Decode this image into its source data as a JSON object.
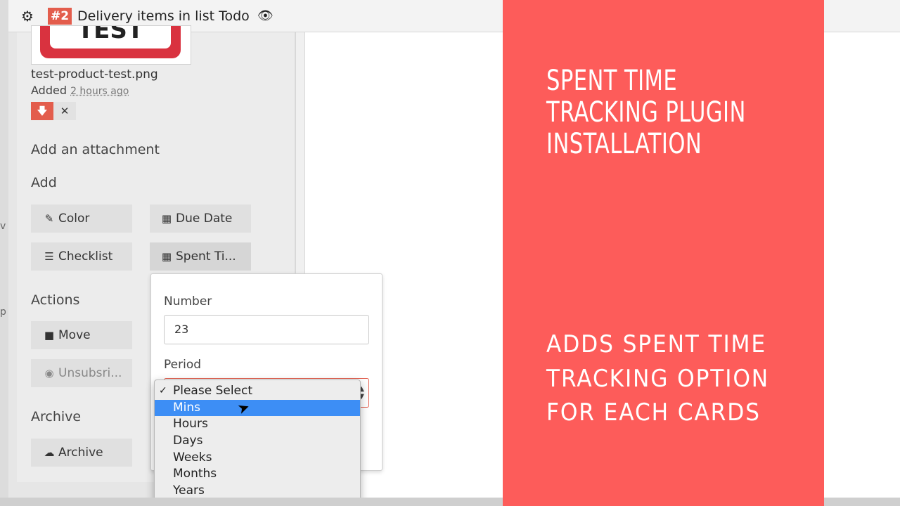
{
  "header": {
    "card_number": "#2",
    "title": "Delivery items in list Todo"
  },
  "attachment": {
    "image_text": "TEST",
    "filename": "test-product-test.png",
    "added_label": "Added",
    "added_time": "2 hours ago"
  },
  "sidebar": {
    "add_attachment": "Add an attachment",
    "add_heading": "Add",
    "buttons": {
      "color": "Color",
      "due_date": "Due Date",
      "checklist": "Checklist",
      "spent_time": "Spent Ti..."
    },
    "actions_heading": "Actions",
    "move": "Move",
    "unsubscribe": "Unsubsri...",
    "archive_heading": "Archive",
    "archive": "Archive"
  },
  "popup": {
    "number_label": "Number",
    "number_value": "23",
    "period_label": "Period"
  },
  "dropdown": {
    "selected": "Please Select",
    "highlighted": "Mins",
    "options": [
      "Please Select",
      "Mins",
      "Hours",
      "Days",
      "Weeks",
      "Months",
      "Years"
    ]
  },
  "banner": {
    "title": "SPENT TIME TRACKING PLUGIN INSTALLATION",
    "subtitle": "ADDS SPENT TIME TRACKING OPTION FOR EACH CARDS",
    "background_color": "#fd5c5a"
  },
  "colors": {
    "accent": "#e35d4c",
    "highlight": "#3d8ef5"
  }
}
